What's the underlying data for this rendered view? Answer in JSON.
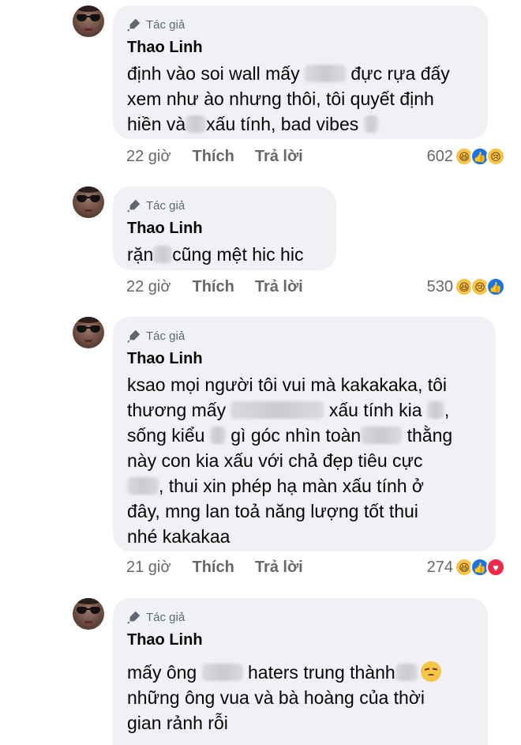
{
  "comments": [
    {
      "author_tag": "Tác giả",
      "name": "Thao Linh",
      "line1a": "định vào soi wall mấy",
      "line1b": "đực rựa đấy",
      "line2": "xem như ào nhưng thôi, tôi quyết định",
      "line3a": "hiền và",
      "line3b": "xấu tính, bad vibes",
      "time": "22 giờ",
      "like": "Thích",
      "reply": "Trả lời",
      "count": "602",
      "reactions": [
        "haha",
        "like",
        "sad"
      ]
    },
    {
      "author_tag": "Tác giả",
      "name": "Thao Linh",
      "line1a": "rặn",
      "line1b": "cũng mệt hic hic",
      "time": "22 giờ",
      "like": "Thích",
      "reply": "Trả lời",
      "count": "530",
      "reactions": [
        "haha",
        "sad",
        "like"
      ]
    },
    {
      "author_tag": "Tác giả",
      "name": "Thao Linh",
      "line1": "ksao mọi người tôi vui mà kakakaka, tôi",
      "line2a": "thương mấy",
      "line2b": "xấu tính kia",
      "line3a": "sống kiểu",
      "line3b": "gì góc nhìn toàn",
      "line3c": "thằng",
      "line4": "này con kia xấu với chả đẹp tiêu cực",
      "line5b": ", thui xin phép hạ màn xấu tính ở",
      "line6": "đây, mng lan toả năng lượng tốt thui",
      "line7": "nhé kakakaa",
      "time": "21 giờ",
      "like": "Thích",
      "reply": "Trả lời",
      "count": "274",
      "reactions": [
        "haha",
        "like",
        "love"
      ]
    },
    {
      "author_tag": "Tác giả",
      "name": "Thao Linh",
      "line1a": "mấy ông",
      "line1b": "haters trung thành",
      "line2": "những ông vua và bà hoàng của thời",
      "line3": "gian rảnh rỗi"
    }
  ]
}
